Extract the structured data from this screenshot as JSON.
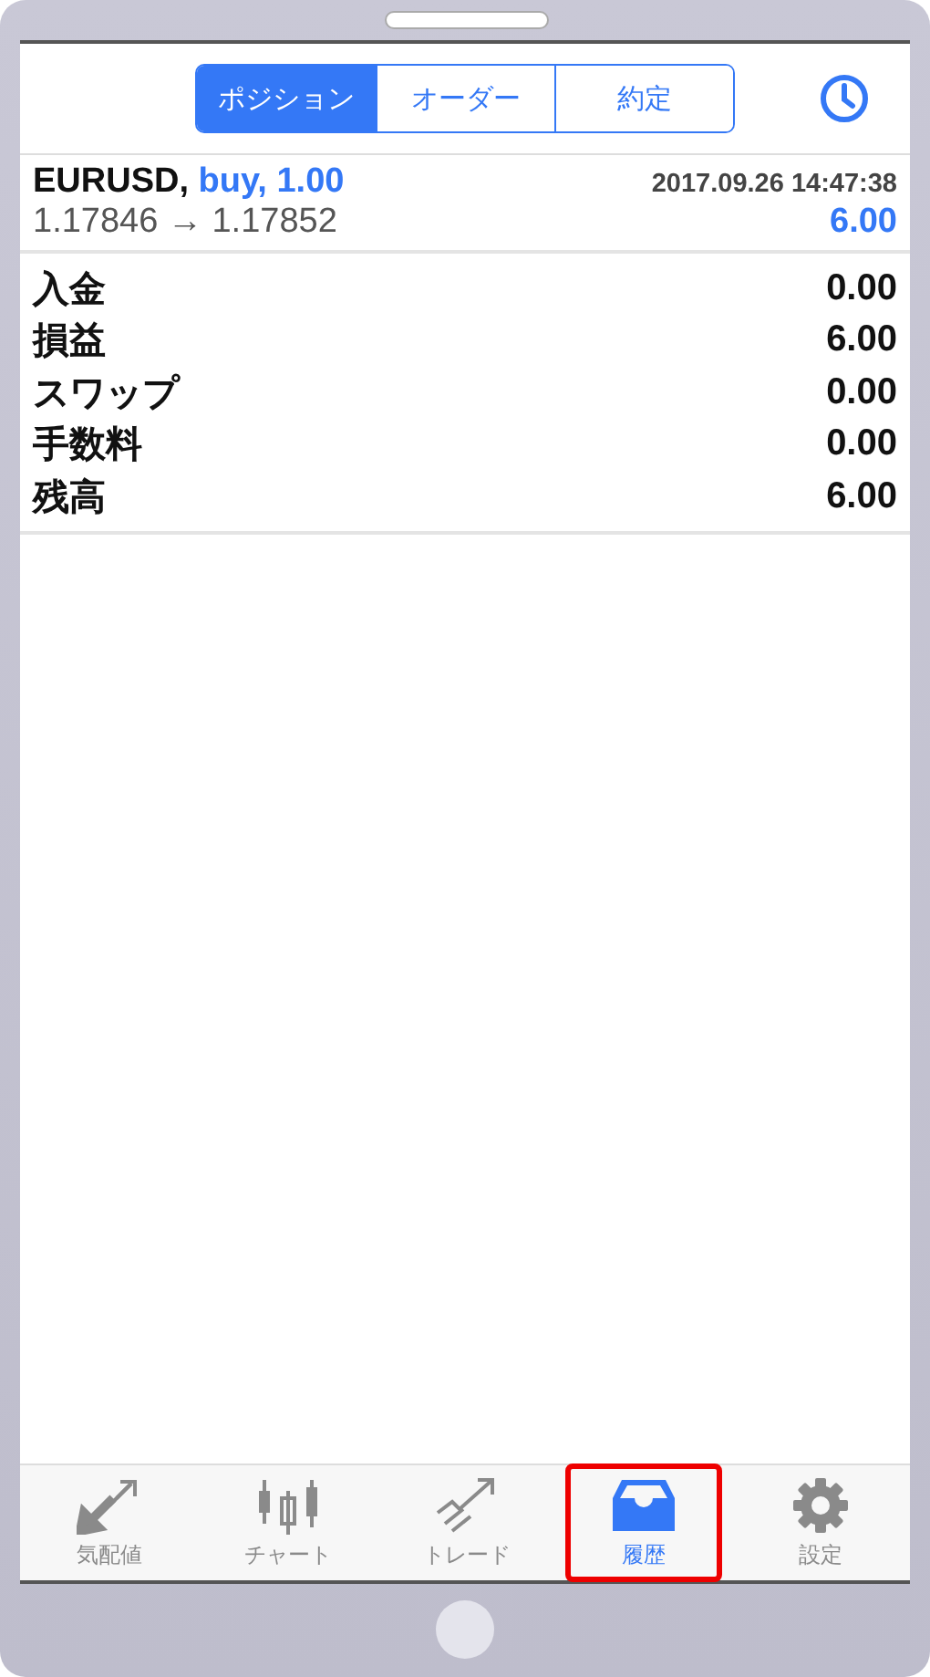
{
  "segments": [
    {
      "label": "ポジション",
      "selected": true
    },
    {
      "label": "オーダー",
      "selected": false
    },
    {
      "label": "約定",
      "selected": false
    }
  ],
  "trade": {
    "symbol": "EURUSD,",
    "side": "buy, 1.00",
    "time": "2017.09.26 14:47:38",
    "prices": "1.17846 → 1.17852",
    "profit": "6.00"
  },
  "summary": [
    {
      "label": "入金",
      "value": "0.00"
    },
    {
      "label": "損益",
      "value": "6.00"
    },
    {
      "label": "スワップ",
      "value": "0.00"
    },
    {
      "label": "手数料",
      "value": "0.00"
    },
    {
      "label": "残高",
      "value": "6.00"
    }
  ],
  "tab_bar": [
    {
      "kind": "quotes",
      "label": "気配値",
      "selected": false,
      "highlighted": false
    },
    {
      "kind": "chart",
      "label": "チャート",
      "selected": false,
      "highlighted": false
    },
    {
      "kind": "trade",
      "label": "トレード",
      "selected": false,
      "highlighted": false
    },
    {
      "kind": "history",
      "label": "履歴",
      "selected": true,
      "highlighted": true
    },
    {
      "kind": "settings",
      "label": "設定",
      "selected": false,
      "highlighted": false
    }
  ]
}
